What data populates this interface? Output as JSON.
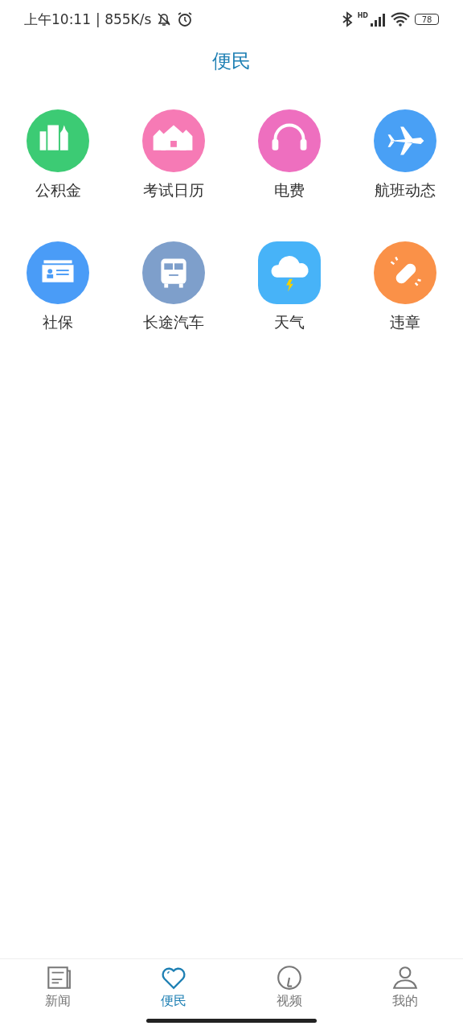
{
  "status_bar": {
    "time": "上午10:11",
    "speed": "| 855K/s",
    "network": "HD",
    "battery": "78"
  },
  "title": "便民",
  "services": [
    {
      "label": "公积金",
      "kind": "buildings",
      "color": "#3ccb74"
    },
    {
      "label": "考试日历",
      "kind": "houses",
      "color": "#f67ab5"
    },
    {
      "label": "电费",
      "kind": "headphones",
      "color": "#ee6fbf"
    },
    {
      "label": "航班动态",
      "kind": "plane",
      "color": "#49a0f5"
    },
    {
      "label": "社保",
      "kind": "card",
      "color": "#4a9cf7"
    },
    {
      "label": "长途汽车",
      "kind": "bus",
      "color": "#7e9fcb"
    },
    {
      "label": "天气",
      "kind": "weather",
      "color": "#47b3f8"
    },
    {
      "label": "违章",
      "kind": "bandage",
      "color": "#fa9148"
    }
  ],
  "tabs": [
    {
      "label": "新闻",
      "kind": "news",
      "selected": false
    },
    {
      "label": "便民",
      "kind": "heart",
      "selected": true
    },
    {
      "label": "视频",
      "kind": "video",
      "selected": false
    },
    {
      "label": "我的",
      "kind": "person",
      "selected": false
    }
  ]
}
